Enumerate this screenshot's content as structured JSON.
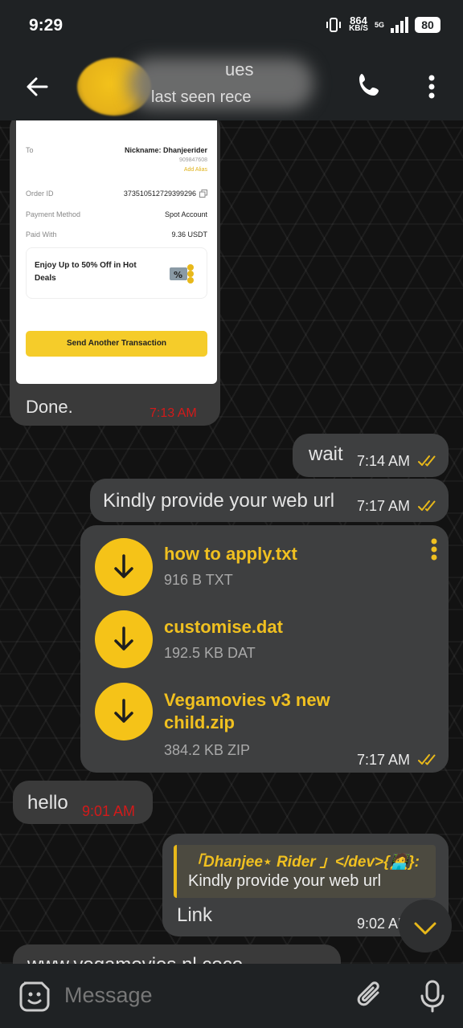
{
  "status_bar": {
    "time": "9:29",
    "speed_value": "864",
    "speed_unit": "KB/S",
    "network": "5G",
    "battery": "80"
  },
  "header": {
    "contact_name": "ues",
    "last_seen": "last seen rece"
  },
  "receipt": {
    "to_label": "To",
    "nickname": "Nickname: Dhanjeerider",
    "uid": "909847608",
    "add_alias": "Add Alias",
    "order_id_label": "Order ID",
    "order_id": "373510512729399296",
    "payment_method_label": "Payment Method",
    "payment_method": "Spot Account",
    "paid_with_label": "Paid With",
    "paid_with": "9.36 USDT",
    "promo_text": "Enjoy Up to 50% Off in Hot Deals",
    "send_button": "Send Another Transaction"
  },
  "messages": {
    "done": {
      "text": "Done.",
      "time": "7:13 AM"
    },
    "wait": {
      "text": "wait",
      "time": "7:14 AM"
    },
    "kindly": {
      "text": "Kindly provide your web url",
      "time": "7:17 AM"
    },
    "files": {
      "items": [
        {
          "name": "how to apply.txt",
          "meta": "916 B TXT"
        },
        {
          "name": "customise.dat",
          "meta": "192.5 KB DAT"
        },
        {
          "name_line1": "Vegamovies v3 new",
          "name_line2": "child.zip",
          "meta": "384.2 KB ZIP"
        }
      ],
      "time": "7:17 AM"
    },
    "hello": {
      "text": "hello",
      "time": "9:01 AM"
    },
    "reply": {
      "quote_name": "「Dhanjee⋆ Rider 」</dev>{🧑‍💻}:",
      "quote_text": "Kindly provide your web url",
      "text": "Link",
      "time": "9:02 AM"
    },
    "partial": {
      "text": "www.vegamovies.nl.coco"
    }
  },
  "composer": {
    "placeholder": "Message"
  },
  "colors": {
    "accent": "#f5c318",
    "bubble": "#3a3a3a",
    "read_tick": "#e8b81a",
    "time_red": "#d21a1a"
  }
}
